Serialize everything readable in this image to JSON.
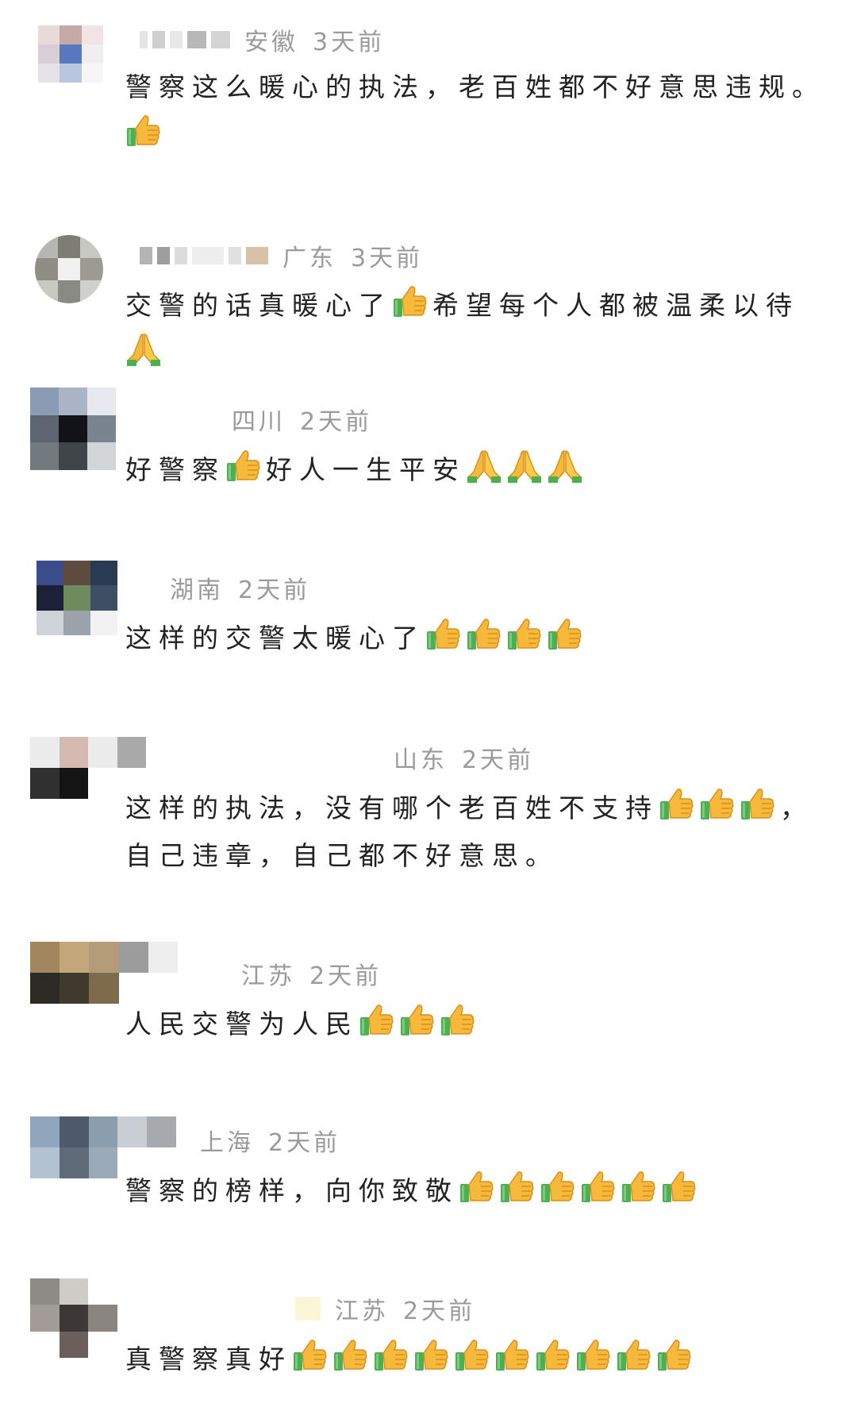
{
  "comments": [
    {
      "region": "安徽",
      "time": "3天前",
      "text": "警察这么暖心的执法，老百姓都不好意思违规。",
      "emojis": [
        "thumbs-up-icon"
      ]
    },
    {
      "region": "广东",
      "time": "3天前",
      "text_a": "交警的话真暖心了",
      "text_b": "希望每个人都被温柔以待",
      "emojis": [
        "thumbs-up-icon",
        "folded-hands-icon"
      ]
    },
    {
      "region": "四川",
      "time": "2天前",
      "text_a": "好警察",
      "text_b": "好人一生平安",
      "emojis": [
        "thumbs-up-icon",
        "folded-hands-icon",
        "folded-hands-icon",
        "folded-hands-icon"
      ]
    },
    {
      "region": "湖南",
      "time": "2天前",
      "text": "这样的交警太暖心了",
      "emojis": [
        "thumbs-up-icon",
        "thumbs-up-icon",
        "thumbs-up-icon",
        "thumbs-up-icon"
      ]
    },
    {
      "region": "山东",
      "time": "2天前",
      "text_a": "这样的执法，没有哪个老百姓不支持",
      "text_b": "，自己违章，自己都不好意思。",
      "emojis": [
        "thumbs-up-icon",
        "thumbs-up-icon",
        "thumbs-up-icon"
      ]
    },
    {
      "region": "江苏",
      "time": "2天前",
      "text": "人民交警为人民",
      "emojis": [
        "thumbs-up-icon",
        "thumbs-up-icon",
        "thumbs-up-icon"
      ]
    },
    {
      "region": "上海",
      "time": "2天前",
      "text": "警察的榜样，向你致敬",
      "emojis": [
        "thumbs-up-icon",
        "thumbs-up-icon",
        "thumbs-up-icon",
        "thumbs-up-icon",
        "thumbs-up-icon",
        "thumbs-up-icon"
      ]
    },
    {
      "region": "江苏",
      "time": "2天前",
      "text": "真警察真好",
      "emojis": [
        "thumbs-up-icon",
        "thumbs-up-icon",
        "thumbs-up-icon",
        "thumbs-up-icon",
        "thumbs-up-icon",
        "thumbs-up-icon",
        "thumbs-up-icon",
        "thumbs-up-icon",
        "thumbs-up-icon",
        "thumbs-up-icon"
      ]
    }
  ],
  "colors": {
    "text": "#222222",
    "meta": "#9a9a9a",
    "thumb": "#f6b93b",
    "sleeve": "#4caf50"
  }
}
